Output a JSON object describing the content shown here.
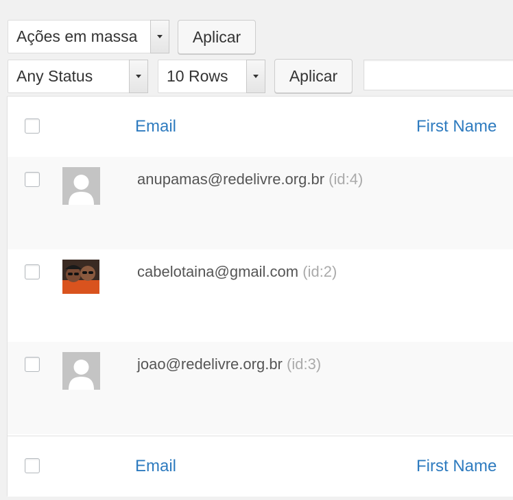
{
  "toolbar": {
    "bulk_actions": {
      "selected": "Ações em massa"
    },
    "apply_bulk_label": "Aplicar",
    "status_filter": {
      "selected": "Any Status"
    },
    "rows_filter": {
      "selected": "10 Rows"
    },
    "apply_filter_label": "Aplicar",
    "search": {
      "value": ""
    }
  },
  "table": {
    "columns": {
      "email": "Email",
      "first_name": "First Name"
    },
    "rows": [
      {
        "email": "anupamas@redelivre.org.br",
        "id": "(id:4)",
        "avatar": "default-avatar",
        "striped": true
      },
      {
        "email": "cabelotaina@gmail.com",
        "id": "(id:2)",
        "avatar": "photo-avatar",
        "striped": false
      },
      {
        "email": "joao@redelivre.org.br",
        "id": "(id:3)",
        "avatar": "default-avatar",
        "striped": true
      }
    ]
  },
  "colors": {
    "link": "#2e7bbf",
    "stripe": "#f9f9f9",
    "page_bg": "#f1f1f1"
  }
}
